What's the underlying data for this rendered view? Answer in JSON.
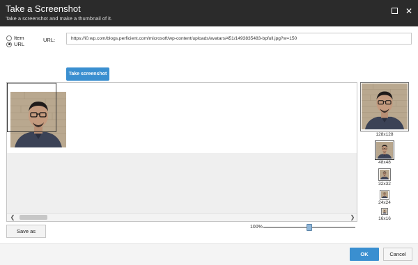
{
  "window": {
    "title": "Take a Screenshot",
    "subtitle": "Take a screenshot and make a thumbnail of it.",
    "maximize_icon": "maximize-icon",
    "close_icon": "close-icon",
    "close_glyph": "✕"
  },
  "source": {
    "options": [
      {
        "label": "Item",
        "checked": false
      },
      {
        "label": "URL",
        "checked": true
      }
    ]
  },
  "url": {
    "label": "URL:",
    "value": "https://i0.wp.com/blogs.perficient.com/microsoft/wp-content/uploads/avatars/451/1493835483-bpfull.jpg?w=150"
  },
  "toolbar": {
    "take_screenshot_label": "Take screenshot",
    "save_as_label": "Save as"
  },
  "scrollbar": {
    "left_glyph": "❮",
    "right_glyph": "❯"
  },
  "zoom": {
    "label": "100%",
    "fraction": 0.5
  },
  "previews": [
    {
      "label": "128x128",
      "selected": false
    },
    {
      "label": "48x48",
      "selected": true
    },
    {
      "label": "32x32",
      "selected": false
    },
    {
      "label": "24x24",
      "selected": false
    },
    {
      "label": "16x16",
      "selected": false
    }
  ],
  "footer": {
    "ok_label": "OK",
    "cancel_label": "Cancel"
  },
  "colors": {
    "titlebar": "#2b2b2b",
    "accent": "#3a8fd0"
  }
}
